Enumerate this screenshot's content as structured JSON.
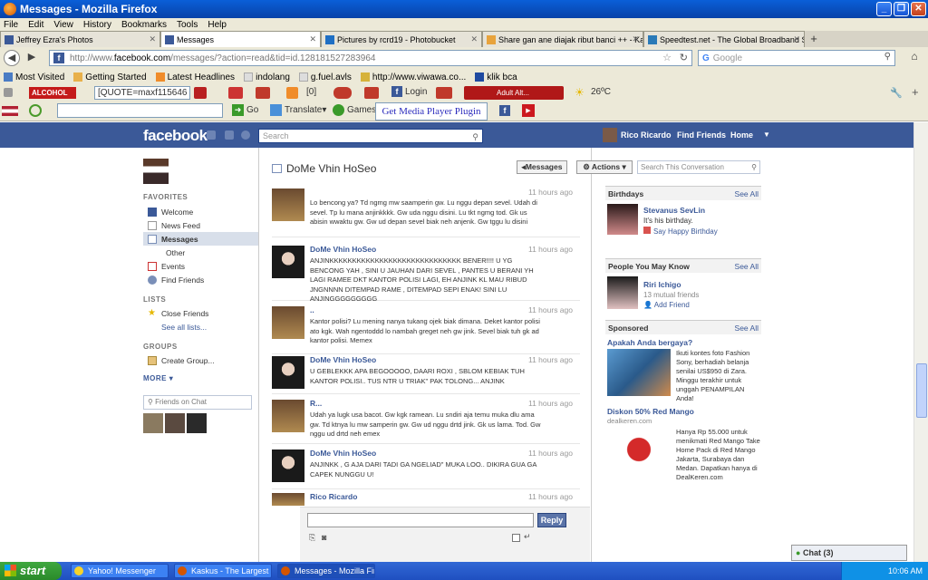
{
  "window": {
    "title": "Messages - Mozilla Firefox"
  },
  "menu": [
    "File",
    "Edit",
    "View",
    "History",
    "Bookmarks",
    "Tools",
    "Help"
  ],
  "tabs": [
    {
      "label": "Jeffrey Ezra's Photos"
    },
    {
      "label": "Messages"
    },
    {
      "label": "Pictures by rcrd19 - Photobucket"
    },
    {
      "label": "Share gan ane diajak ribut banci ++ - Ka..."
    },
    {
      "label": "Speedtest.net - The Global Broadband S..."
    }
  ],
  "nav": {
    "url_prefix": "http://www.",
    "url_domain": "facebook.com",
    "url_rest": "/messages/?action=read&tid=id.128181527283964",
    "search_placeholder": "Google"
  },
  "bookmarks": [
    "Most Visited",
    "Getting Started",
    "Latest Headlines",
    "indolang",
    "g.fuel.avls",
    "http://www.viwawa.co...",
    "klik bca"
  ],
  "toolbar1": {
    "quote_text": "[QUOTE=maxf115646",
    "counter": "[0]",
    "login": "Login",
    "adult": "Adult Alt...",
    "temp": "26ºC"
  },
  "toolbar2": {
    "go": "Go",
    "translate": "Translate",
    "games": "Games",
    "plugin": "Get Media Player Plugin"
  },
  "fb": {
    "logo": "facebook",
    "search_placeholder": "Search",
    "user": "Rico Ricardo",
    "find_friends": "Find Friends",
    "home": "Home"
  },
  "sidebar": {
    "favorites_title": "FAVORITES",
    "favorites": [
      "Welcome",
      "News Feed",
      "Messages",
      "Other",
      "Events",
      "Find Friends"
    ],
    "lists_title": "LISTS",
    "lists": [
      "Close Friends",
      "See all lists..."
    ],
    "groups_title": "GROUPS",
    "groups": [
      "Create Group..."
    ],
    "more": "MORE",
    "chat_search": "Friends on Chat"
  },
  "conversation": {
    "title": "DoMe Vhin HoSeo",
    "messages_btn": "Messages",
    "actions_btn": "Actions",
    "search_placeholder": "Search This Conversation",
    "messages": [
      {
        "sender": "",
        "time": "11 hours ago",
        "text": "Lo bencong ya? Td ngmg mw saamperin gw. Lu nggu depan sevel. Udah di sevel. Tp lu mana anjinkkkk. Gw uda nggu disini. Lu tkt ngmg tod. Gk us abisin wwaktu gw. Gw ud depan sevel biak neh anjenk. Gw tggu lu disini"
      },
      {
        "sender": "DoMe Vhin HoSeo",
        "time": "11 hours ago",
        "text": "ANJINKKKKKKKKKKKKKKKKKKKKKKKKKKKKK BENER!!!! U YG BENCONG YAH , SINI U JAUHAN DARI SEVEL , PANTES U BERANI YH LAGI RAMEE DKT KANTOR POLISI LAGI, EH ANJINK KL MAU RIBUD JNGNNNN DITEMPAD RAME , DITEMPAD SEPI ENAK! SINI LU ANJINGGGGGGGGG"
      },
      {
        "sender": "..",
        "time": "11 hours ago",
        "text": "Kantor polisi? Lu mening nanya tukang ojek biak dimana. Deket kantor polisi ato kgk. Wah ngentoddd lo nambah greget neh gw jink. Sevel biak tuh gk ad kantor polisi. Memex"
      },
      {
        "sender": "DoMe Vhin HoSeo",
        "time": "11 hours ago",
        "text": "U GEBLEKKK APA BEGOOOOO, DAARI ROXI , SBLOM KEBIAK TUH KANTOR POLISI.. TUS NTR U TRIAK\" PAK TOLONG... ANJINK"
      },
      {
        "sender": "R...",
        "time": "11 hours ago",
        "text": "Udah ya lugk usa bacot. Gw kgk ramean. Lu sndiri aja temu muka dlu ama gw. Td ktnya lu mw samperin gw. Gw ud nggu drtd jink. Gk us lama. Tod. Gw nggu ud drtd neh emex"
      },
      {
        "sender": "DoMe Vhin HoSeo",
        "time": "11 hours ago",
        "text": "ANJINKK , G AJA DARI TADI GA NGELIAD\" MUKA LOO.. DIKIRA GUA GA CAPEK NUNGGU U!"
      },
      {
        "sender": "Rico Ricardo",
        "time": "11 hours ago",
        "text": ""
      }
    ],
    "reply_btn": "Reply"
  },
  "right": {
    "birthdays_title": "Birthdays",
    "see_all": "See All",
    "birthday_name": "Stevanus SevLin",
    "birthday_text": "It's his birthday.",
    "birthday_action": "Say Happy Birthday",
    "pymk_title": "People You May Know",
    "pymk_name": "Riri Ichigo",
    "pymk_mutual": "13 mutual friends",
    "pymk_action": "Add Friend",
    "sponsored_title": "Sponsored",
    "ad1_title": "Apakah Anda bergaya?",
    "ad1_text": "Ikuti kontes foto Fashion Sony, berhadiah belanja senilai US$950 di Zara. Minggu terakhir untuk unggah PENAMPILAN Anda!",
    "ad2_title": "Diskon 50% Red Mango",
    "ad2_domain": "dealkeren.com",
    "ad2_text": "Hanya Rp 55.000 untuk menikmati Red Mango Take Home Pack di Red Mango Jakarta, Surabaya dan Medan. Dapatkan hanya di DealKeren.com"
  },
  "chat": {
    "label": "Chat (3)"
  },
  "taskbar": {
    "start": "start",
    "items": [
      "Yahoo! Messenger",
      "Kaskus - The Largest ...",
      "Messages - Mozilla Fir..."
    ],
    "clock": "10:06 AM"
  },
  "colors": {
    "fb_blue": "#3b5998",
    "xp_blue": "#245edb",
    "link": "#3b5998"
  }
}
